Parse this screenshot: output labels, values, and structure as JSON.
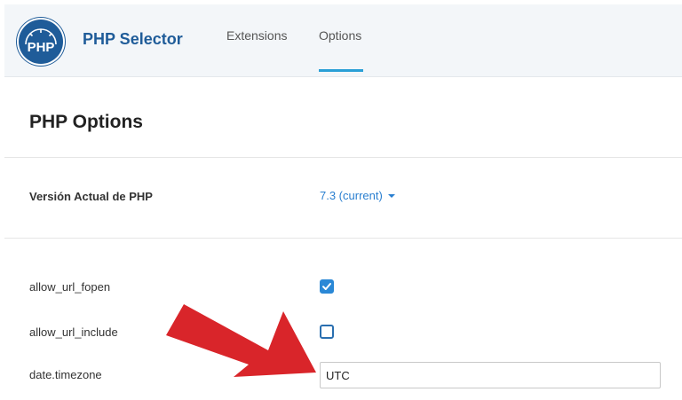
{
  "header": {
    "app_title": "PHP Selector",
    "logo_text": "PHP",
    "tabs": [
      {
        "label": "Extensions",
        "active": false
      },
      {
        "label": "Options",
        "active": true
      }
    ]
  },
  "main": {
    "section_title": "PHP Options",
    "version": {
      "label": "Versión Actual de PHP",
      "value": "7.3 (current)"
    },
    "options": [
      {
        "name": "allow_url_fopen",
        "type": "checkbox",
        "checked": true
      },
      {
        "name": "allow_url_include",
        "type": "checkbox",
        "checked": false
      },
      {
        "name": "date.timezone",
        "type": "text",
        "value": "UTC"
      }
    ]
  },
  "icons": {
    "logo": "php-logo-icon",
    "dropdown": "caret-down-icon",
    "check": "check-icon",
    "annotation": "red-arrow-icon"
  },
  "colors": {
    "brand": "#1f5c99",
    "accent": "#2a9fd6",
    "link": "#2a7fd0",
    "checkbox": "#2a88d6",
    "annotation_arrow": "#d9252a",
    "header_bg": "#f3f6f9"
  }
}
